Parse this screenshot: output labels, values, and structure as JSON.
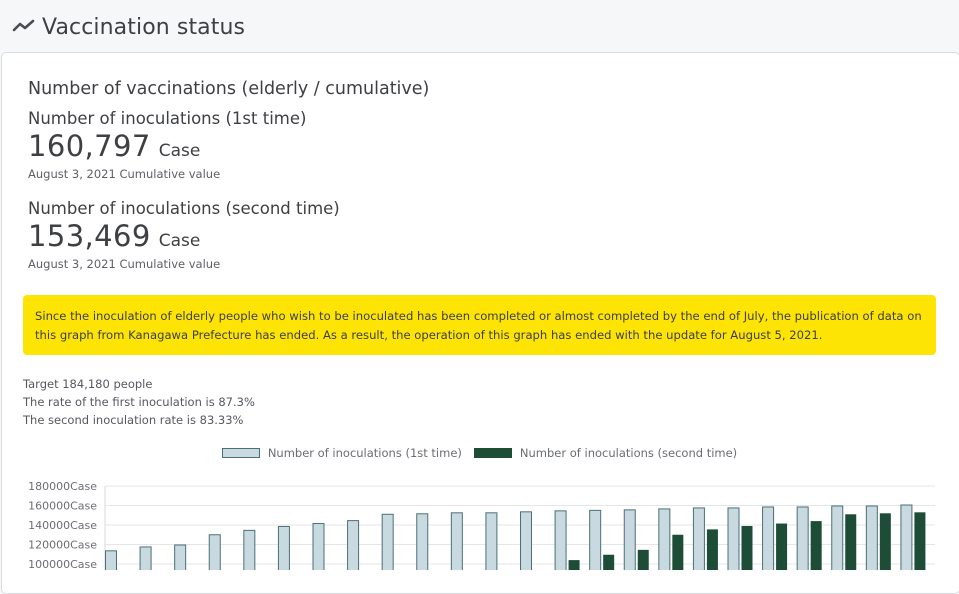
{
  "header": {
    "title": "Vaccination status",
    "icon": "trend-line-icon"
  },
  "card": {
    "title": "Number of vaccinations (elderly / cumulative)",
    "first": {
      "label": "Number of inoculations (1st time)",
      "value": "160,797",
      "unit": "Case",
      "date": "August 3, 2021 Cumulative value"
    },
    "second": {
      "label": "Number of inoculations (second time)",
      "value": "153,469",
      "unit": "Case",
      "date": "August 3, 2021 Cumulative value"
    },
    "notice": "Since the inoculation of elderly people who wish to be inoculated has been completed or almost completed by the end of July, the publication of data on this graph from Kanagawa Prefecture has ended. As a result, the operation of this graph has ended with the update for August 5, 2021.",
    "stats": {
      "target": "Target 184,180 people",
      "first_rate": "The rate of the first inoculation is 87.3%",
      "second_rate": "The second inoculation rate is 83.33%"
    }
  },
  "colors": {
    "first_fill": "#c8dae0",
    "first_stroke": "#4a6f78",
    "second_fill": "#1d4d36",
    "notice_bg": "#fde405"
  },
  "chart_data": {
    "type": "bar",
    "ylim": [
      100000,
      180000
    ],
    "y_ticks": [
      "180000Case",
      "160000Case",
      "140000Case",
      "120000Case",
      "100000Case"
    ],
    "legend": [
      "Number of inoculations (1st time)",
      "Number of inoculations (second time)"
    ],
    "series": [
      {
        "name": "Number of inoculations (1st time)",
        "values": [
          113500,
          117500,
          119500,
          130000,
          134500,
          138500,
          141500,
          144500,
          151000,
          151500,
          152500,
          152500,
          153500,
          154500,
          155000,
          155500,
          156500,
          157500,
          157500,
          158500,
          158500,
          159500,
          159500,
          160500
        ]
      },
      {
        "name": "Number of inoculations (second time)",
        "values": [
          null,
          null,
          null,
          null,
          null,
          null,
          null,
          null,
          null,
          null,
          null,
          null,
          null,
          104000,
          109500,
          114500,
          130000,
          135500,
          139000,
          141500,
          144000,
          151000,
          152000,
          153000
        ]
      }
    ]
  }
}
